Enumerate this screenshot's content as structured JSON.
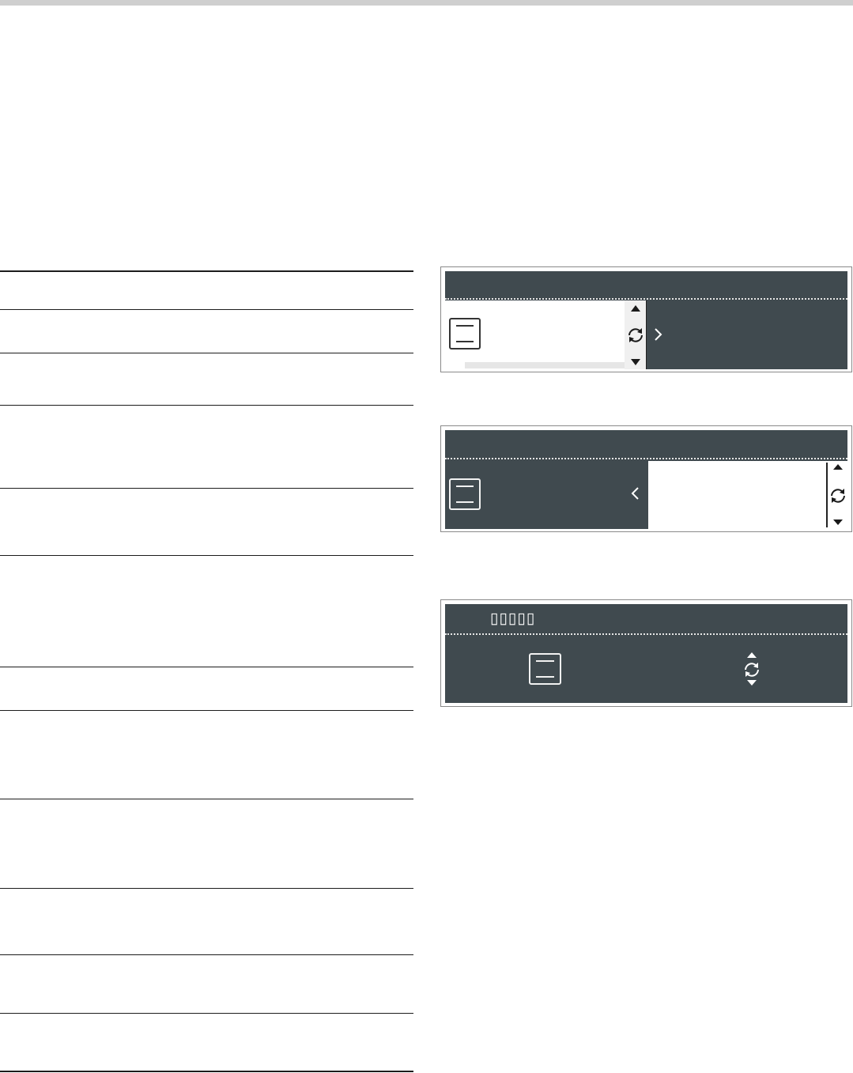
{
  "page": {
    "top_bar_color": "#cfcfcf"
  },
  "table": {
    "row_count": 12
  },
  "panels": {
    "dark_color": "#404a4f",
    "panel3": {
      "mode_label": "▯▯▯▯▯"
    }
  },
  "icons": {
    "oven": "oven-icon",
    "rotate": "rotate-selector-icon",
    "up": "triangle-up-icon",
    "down": "triangle-down-icon",
    "right": "chevron-right-icon",
    "left": "chevron-left-icon"
  }
}
